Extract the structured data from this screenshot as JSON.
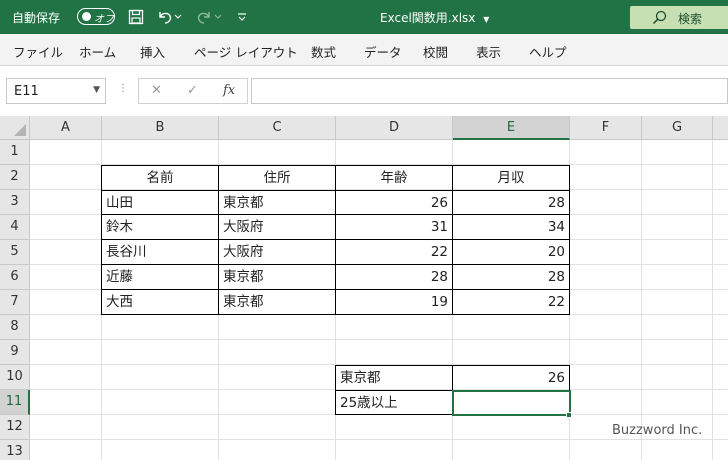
{
  "titlebar": {
    "autosave_label": "自動保存",
    "autosave_state": "オフ",
    "filename": "Excel関数用.xlsx",
    "search_label": "検索"
  },
  "ribbon": {
    "tabs": [
      "ファイル",
      "ホーム",
      "挿入",
      "ページ レイアウト",
      "数式",
      "データ",
      "校閲",
      "表示",
      "ヘルプ"
    ]
  },
  "formula_bar": {
    "name_box": "E11",
    "fx_label": "fx",
    "formula": ""
  },
  "sheet": {
    "columns": [
      "A",
      "B",
      "C",
      "D",
      "E",
      "F",
      "G"
    ],
    "rows": [
      "1",
      "2",
      "3",
      "4",
      "5",
      "6",
      "7",
      "8",
      "9",
      "10",
      "11",
      "12",
      "13"
    ],
    "table": {
      "headers": [
        "名前",
        "住所",
        "年齢",
        "月収"
      ],
      "rows": [
        [
          "山田",
          "東京都",
          "26",
          "28"
        ],
        [
          "鈴木",
          "大阪府",
          "31",
          "34"
        ],
        [
          "長谷川",
          "大阪府",
          "22",
          "20"
        ],
        [
          "近藤",
          "東京都",
          "28",
          "28"
        ],
        [
          "大西",
          "東京都",
          "19",
          "22"
        ]
      ]
    },
    "criteria": {
      "d10": "東京都",
      "e10": "26",
      "d11": "25歳以上",
      "e11": ""
    },
    "selected_cell": "E11"
  },
  "watermark": "Buzzword Inc.",
  "colors": {
    "excel_green": "#217346",
    "search_bg": "#c6e0b4"
  }
}
